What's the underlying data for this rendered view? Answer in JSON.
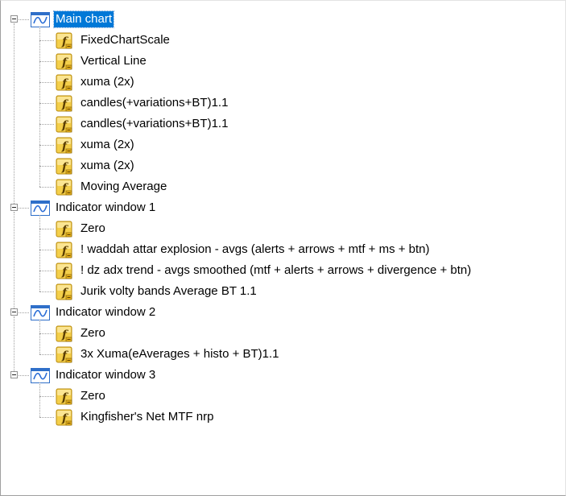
{
  "tree": {
    "groups": [
      {
        "label": "Main chart",
        "selected": true,
        "icon": "chart-window-icon",
        "children": [
          {
            "label": "FixedChartScale",
            "icon": "function-icon"
          },
          {
            "label": "Vertical Line",
            "icon": "function-icon"
          },
          {
            "label": "xuma (2x)",
            "icon": "function-icon"
          },
          {
            "label": "candles(+variations+BT)1.1",
            "icon": "function-icon"
          },
          {
            "label": "candles(+variations+BT)1.1",
            "icon": "function-icon"
          },
          {
            "label": "xuma (2x)",
            "icon": "function-icon"
          },
          {
            "label": "xuma (2x)",
            "icon": "function-icon"
          },
          {
            "label": "Moving Average",
            "icon": "function-icon"
          }
        ]
      },
      {
        "label": "Indicator window 1",
        "selected": false,
        "icon": "chart-window-icon",
        "children": [
          {
            "label": "Zero",
            "icon": "function-icon"
          },
          {
            "label": "! waddah attar explosion - avgs (alerts + arrows + mtf + ms + btn)",
            "icon": "function-icon"
          },
          {
            "label": "! dz adx trend - avgs smoothed (mtf + alerts + arrows + divergence + btn)",
            "icon": "function-icon"
          },
          {
            "label": "Jurik volty bands Average BT 1.1",
            "icon": "function-icon"
          }
        ]
      },
      {
        "label": "Indicator window 2",
        "selected": false,
        "icon": "chart-window-icon",
        "children": [
          {
            "label": "Zero",
            "icon": "function-icon"
          },
          {
            "label": "3x Xuma(eAverages + histo + BT)1.1",
            "icon": "function-icon"
          }
        ]
      },
      {
        "label": "Indicator window 3",
        "selected": false,
        "icon": "chart-window-icon",
        "children": [
          {
            "label": "Zero",
            "icon": "function-icon"
          },
          {
            "label": "Kingfisher's Net MTF nrp",
            "icon": "function-icon"
          }
        ]
      }
    ],
    "colors": {
      "selection": "#0078d7",
      "icon_gold": "#f2c12e",
      "icon_blue": "#1a66c9"
    }
  }
}
